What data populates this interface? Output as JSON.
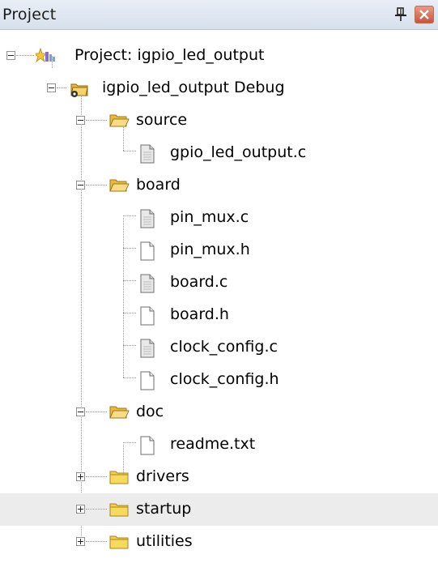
{
  "panel": {
    "title": "Project"
  },
  "tree": {
    "root": "Project: igpio_led_output",
    "target": "igpio_led_output Debug",
    "groups": [
      {
        "label": "source",
        "expanded": true,
        "files": [
          "gpio_led_output.c"
        ]
      },
      {
        "label": "board",
        "expanded": true,
        "files": [
          "pin_mux.c",
          "pin_mux.h",
          "board.c",
          "board.h",
          "clock_config.c",
          "clock_config.h"
        ]
      },
      {
        "label": "doc",
        "expanded": true,
        "files": [
          "readme.txt"
        ]
      },
      {
        "label": "drivers",
        "expanded": false,
        "files": []
      },
      {
        "label": "startup",
        "expanded": false,
        "files": []
      },
      {
        "label": "utilities",
        "expanded": false,
        "files": []
      }
    ]
  },
  "icons": {
    "pin": "pushpin-icon",
    "close": "close-icon",
    "project": "project-icon",
    "target": "target-icon",
    "folder_open": "folder-open-icon",
    "folder_closed": "folder-icon",
    "source_file": "source-file-icon",
    "header_file": "header-file-icon",
    "text_file": "text-file-icon"
  },
  "colors": {
    "titlebar": "#dfe6f1",
    "selection": "#ececec",
    "close_button": "#d66a50",
    "folder": "#f2c94c"
  }
}
